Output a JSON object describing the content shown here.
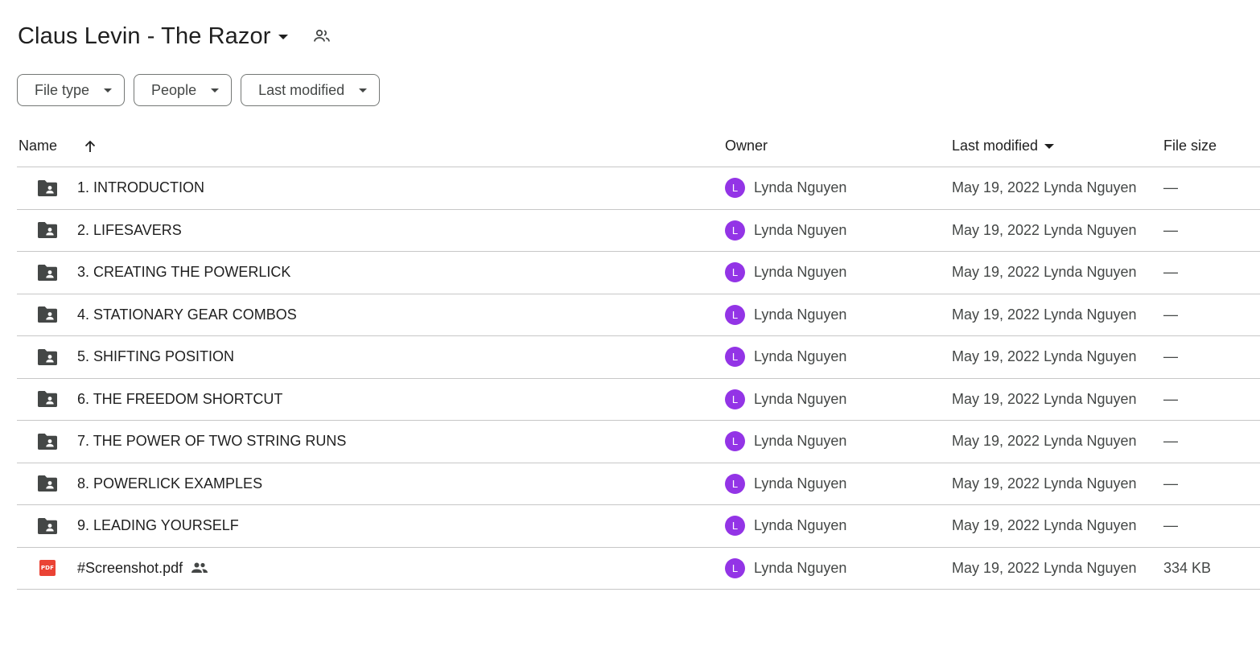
{
  "folder": {
    "title": "Claus Levin - The Razor",
    "shared_icon": "people-icon"
  },
  "filters": {
    "file_type": "File type",
    "people": "People",
    "last_modified": "Last modified"
  },
  "columns": {
    "name": "Name",
    "owner": "Owner",
    "last_modified": "Last modified",
    "file_size": "File size",
    "sort_icon": "arrow-up-icon"
  },
  "rows": [
    {
      "name": "1. INTRODUCTION",
      "type": "shared-folder",
      "owner_initial": "L",
      "owner": "Lynda Nguyen",
      "modified": "May 19, 2022 Lynda Nguyen",
      "size": "—"
    },
    {
      "name": "2. LIFESAVERS",
      "type": "shared-folder",
      "owner_initial": "L",
      "owner": "Lynda Nguyen",
      "modified": "May 19, 2022 Lynda Nguyen",
      "size": "—"
    },
    {
      "name": "3. CREATING THE POWERLICK",
      "type": "shared-folder",
      "owner_initial": "L",
      "owner": "Lynda Nguyen",
      "modified": "May 19, 2022 Lynda Nguyen",
      "size": "—"
    },
    {
      "name": "4. STATIONARY GEAR COMBOS",
      "type": "shared-folder",
      "owner_initial": "L",
      "owner": "Lynda Nguyen",
      "modified": "May 19, 2022 Lynda Nguyen",
      "size": "—"
    },
    {
      "name": "5. SHIFTING POSITION",
      "type": "shared-folder",
      "owner_initial": "L",
      "owner": "Lynda Nguyen",
      "modified": "May 19, 2022 Lynda Nguyen",
      "size": "—"
    },
    {
      "name": "6. THE FREEDOM SHORTCUT",
      "type": "shared-folder",
      "owner_initial": "L",
      "owner": "Lynda Nguyen",
      "modified": "May 19, 2022 Lynda Nguyen",
      "size": "—"
    },
    {
      "name": "7. THE POWER OF TWO STRING RUNS",
      "type": "shared-folder",
      "owner_initial": "L",
      "owner": "Lynda Nguyen",
      "modified": "May 19, 2022 Lynda Nguyen",
      "size": "—"
    },
    {
      "name": "8. POWERLICK EXAMPLES",
      "type": "shared-folder",
      "owner_initial": "L",
      "owner": "Lynda Nguyen",
      "modified": "May 19, 2022 Lynda Nguyen",
      "size": "—"
    },
    {
      "name": "9. LEADING YOURSELF",
      "type": "shared-folder",
      "owner_initial": "L",
      "owner": "Lynda Nguyen",
      "modified": "May 19, 2022 Lynda Nguyen",
      "size": "—"
    },
    {
      "name": "#Screenshot.pdf",
      "type": "pdf",
      "pdf_badge": "PDF",
      "shared": true,
      "owner_initial": "L",
      "owner": "Lynda Nguyen",
      "modified": "May 19, 2022 Lynda Nguyen",
      "size": "334 KB"
    }
  ],
  "colors": {
    "avatar": "#9334e6",
    "pdf": "#ea4335",
    "folder_icon": "#444746"
  }
}
